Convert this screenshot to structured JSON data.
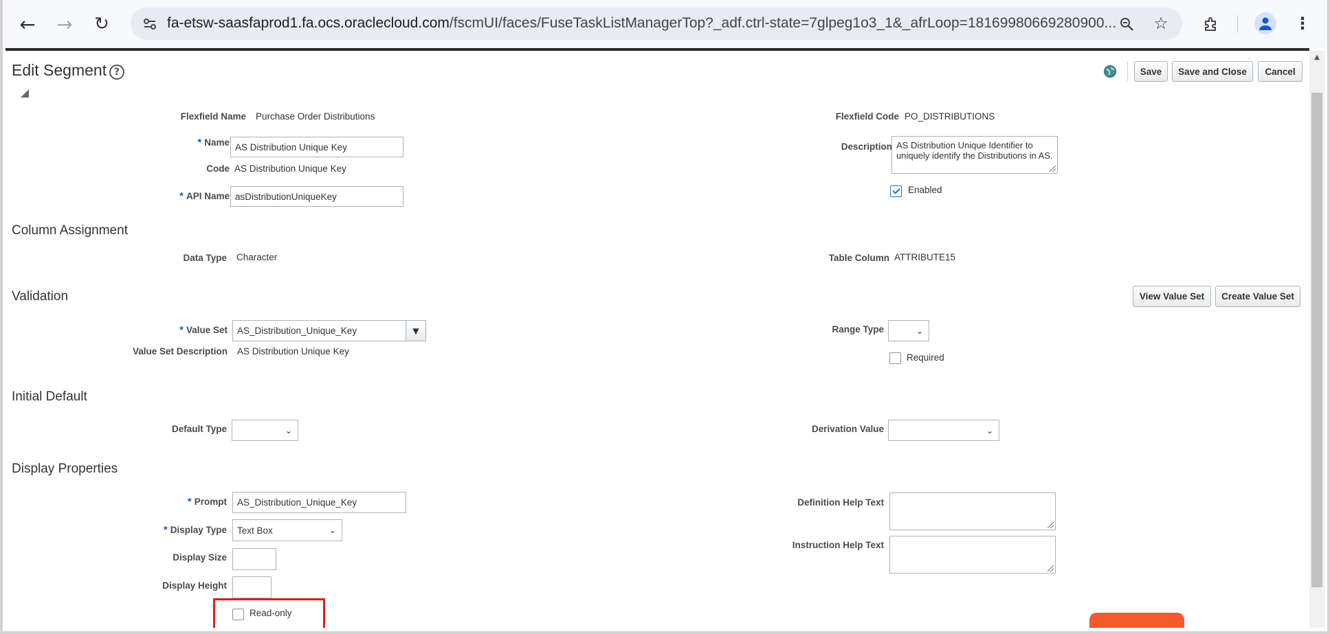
{
  "browser": {
    "url_host": "fa-etsw-saasfaprod1.fa.ocs.oraclecloud.com",
    "url_path": "/fscmUI/faces/FuseTaskListManagerTop?_adf.ctrl-state=7glpeg1o3_1&_afrLoop=18169980669280900..."
  },
  "page": {
    "title": "Edit Segment",
    "buttons": {
      "save": "Save",
      "save_close": "Save and Close",
      "cancel": "Cancel"
    }
  },
  "header": {
    "flexfield_name_label": "Flexfield Name",
    "flexfield_name": "Purchase Order Distributions",
    "flexfield_code_label": "Flexfield Code",
    "flexfield_code": "PO_DISTRIBUTIONS",
    "name_label": "Name",
    "name_value": "AS Distribution Unique Key",
    "code_label": "Code",
    "code_value": "AS Distribution Unique Key",
    "api_label": "API Name",
    "api_value": "asDistributionUniqueKey",
    "description_label": "Description",
    "description_value": "AS Distribution Unique Identifier to uniquely identify the Distributions in AS.",
    "enabled_label": "Enabled",
    "enabled_checked": true
  },
  "column_assignment": {
    "heading": "Column Assignment",
    "data_type_label": "Data Type",
    "data_type": "Character",
    "table_column_label": "Table Column",
    "table_column": "ATTRIBUTE15"
  },
  "validation": {
    "heading": "Validation",
    "view_value_set": "View Value Set",
    "create_value_set": "Create Value Set",
    "value_set_label": "Value Set",
    "value_set": "AS_Distribution_Unique_Key",
    "value_set_desc_label": "Value Set Description",
    "value_set_desc": "AS Distribution Unique Key",
    "range_type_label": "Range Type",
    "range_type": "",
    "required_label": "Required",
    "required_checked": false
  },
  "initial_default": {
    "heading": "Initial Default",
    "default_type_label": "Default Type",
    "default_type": "",
    "derivation_label": "Derivation Value",
    "derivation_value": ""
  },
  "display": {
    "heading": "Display Properties",
    "prompt_label": "Prompt",
    "prompt_value": "AS_Distribution_Unique_Key",
    "display_type_label": "Display Type",
    "display_type": "Text Box",
    "display_size_label": "Display Size",
    "display_size": "",
    "display_height_label": "Display Height",
    "display_height": "",
    "read_only_label": "Read-only",
    "read_only_checked": false,
    "definition_help_label": "Definition Help Text",
    "definition_help": "",
    "instruction_help_label": "Instruction Help Text",
    "instruction_help": ""
  },
  "colors": {
    "accent": "#1e5fa8",
    "highlight": "#e01b1b",
    "chat": "#f55a2c"
  }
}
